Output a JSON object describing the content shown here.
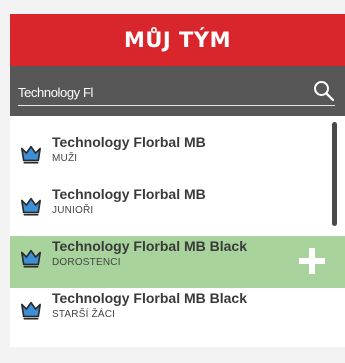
{
  "header": {
    "title": "MŮJ TÝM"
  },
  "search": {
    "value": "Technology Fl"
  },
  "teams": [
    {
      "name": "Technology Florbal MB",
      "category": "MUŽI"
    },
    {
      "name": "Technology Florbal MB",
      "category": "JUNIOŘI"
    },
    {
      "name": "Technology Florbal MB Black",
      "category": "DOROSTENCI"
    },
    {
      "name": "Technology Florbal MB Black",
      "category": "STARŠÍ ŽÁCI"
    }
  ],
  "icons": {
    "team": "crown-icon",
    "search": "search-icon",
    "add": "plus-icon"
  },
  "colors": {
    "header": "#d9262c",
    "search_bar": "#575757",
    "selected_row": "#a9d39c"
  }
}
